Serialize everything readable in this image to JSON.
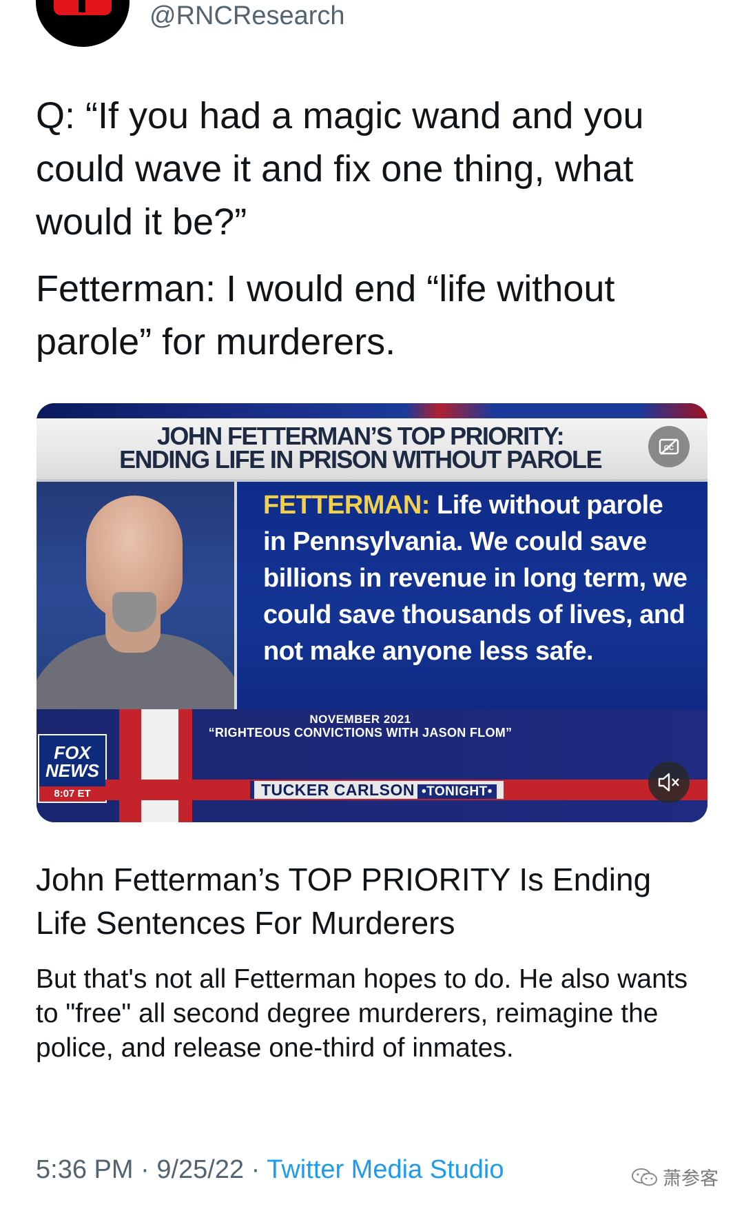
{
  "tweet": {
    "handle": "@RNCResearch",
    "text_p1": "Q: “If you had a magic wand and you could wave it and fix one thing, what would it be?”",
    "text_p2": "Fetterman: I would end “life without parole” for murderers."
  },
  "video": {
    "banner_line1": "JOHN FETTERMAN’S TOP PRIORITY:",
    "banner_line2": "ENDING LIFE IN PRISON WITHOUT PAROLE",
    "quote_speaker": "FETTERMAN:",
    "quote_text": " Life without parole in Pennsylvania. We could save billions in revenue in long term, we could save thousands of lives, and not make anyone less safe.",
    "date_line": "NOVEMBER 2021",
    "source_show": "“RIGHTEOUS CONVICTIONS WITH JASON FLOM”",
    "network_line1": "FOX",
    "network_line2": "NEWS",
    "time": "8:07 ET",
    "ticker_show": "TUCKER CARLSON",
    "ticker_tonight": "•TONIGHT•",
    "icons": {
      "captions": "closed-captions-icon",
      "mute": "muted-speaker-icon"
    }
  },
  "card": {
    "title": "John Fetterman’s TOP PRIORITY Is Ending Life Sentences For Murderers",
    "description": "But that's not all Fetterman hopes to do. He also wants to \"free\" all second degree murderers, reimagine the police, and release one-third of inmates."
  },
  "meta": {
    "time": "5:36 PM",
    "sep": " · ",
    "date": "9/25/22",
    "source": "Twitter Media Studio"
  },
  "watermark": {
    "text": "萧参客",
    "icon": "wechat-icon"
  },
  "colors": {
    "link": "#1d9bf0",
    "secondary": "#536471",
    "fox_red": "#c5232b",
    "fox_blue": "#143494"
  }
}
